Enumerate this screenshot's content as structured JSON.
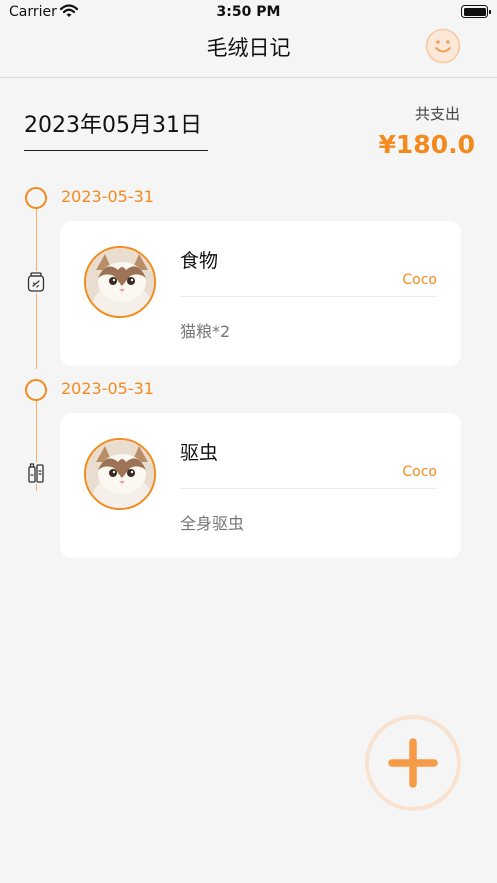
{
  "status_bar": {
    "carrier": "Carrier",
    "time": "3:50 PM"
  },
  "nav": {
    "title": "毛绒日记",
    "profile_icon": "smile-face-icon"
  },
  "header": {
    "selected_date": "2023年05月31日",
    "total_label": "共支出",
    "total_amount": "¥180.0"
  },
  "records": [
    {
      "date": "2023-05-31",
      "category": "食物",
      "icon": "food-jar-icon",
      "pet": "Coco",
      "note": "猫粮*2"
    },
    {
      "date": "2023-05-31",
      "category": "驱虫",
      "icon": "deworm-bottle-icon",
      "pet": "Coco",
      "note": "全身驱虫"
    }
  ],
  "fab": {
    "icon": "plus-icon"
  },
  "colors": {
    "accent": "#f28a1d",
    "fab_ring": "#f9e2cf",
    "background": "#f5f5f5",
    "card": "#ffffff"
  }
}
